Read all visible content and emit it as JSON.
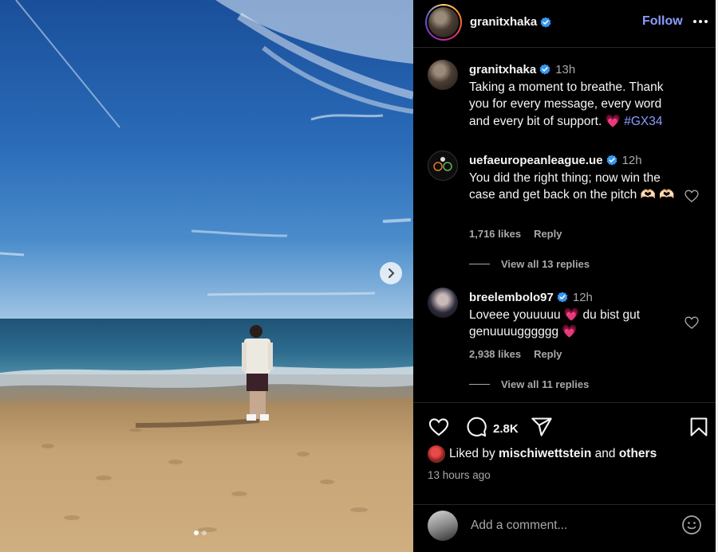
{
  "post": {
    "author": "granitxhaka",
    "follow_label": "Follow",
    "caption_time": "13h",
    "caption_text": "Taking a moment to breathe. Thank you for every message, every word and every bit of support.",
    "caption_emoji": "💗",
    "caption_hashtag": "#GX34"
  },
  "comments": [
    {
      "username": "uefaeuropeanleague.ue",
      "time": "12h",
      "text": "You did the right thing; now win the case and get back on the pitch 🫶🏻 🫶🏻",
      "likes": "1,716 likes",
      "reply_label": "Reply",
      "view_replies": "View all 13 replies"
    },
    {
      "username": "breelembolo97",
      "time": "12h",
      "text": "Loveee youuuuu 💗 du bist gut genuuuugggggg 💗",
      "likes": "2,938 likes",
      "reply_label": "Reply",
      "view_replies": "View all 11 replies"
    }
  ],
  "actions": {
    "comment_count": "2.8K",
    "liked_by_prefix": "Liked by",
    "liked_by_user": "mischiwettstein",
    "liked_by_and": "and",
    "liked_by_others": "others",
    "time_ago": "13 hours ago",
    "add_comment_placeholder": "Add a comment..."
  },
  "icons": {
    "like": "heart-icon",
    "comment": "comment-bubble-icon",
    "share": "paper-plane-icon",
    "save": "bookmark-icon",
    "emoji": "smiley-icon",
    "verified": "verified-badge-icon",
    "more": "more-horizontal-icon",
    "next": "chevron-right-icon"
  },
  "colors": {
    "background": "#000000",
    "text": "#f5f5f5",
    "muted": "#a8a8a8",
    "link": "#8c9cff",
    "verified": "#3897f0"
  },
  "carousel": {
    "total": 2,
    "active": 1
  }
}
